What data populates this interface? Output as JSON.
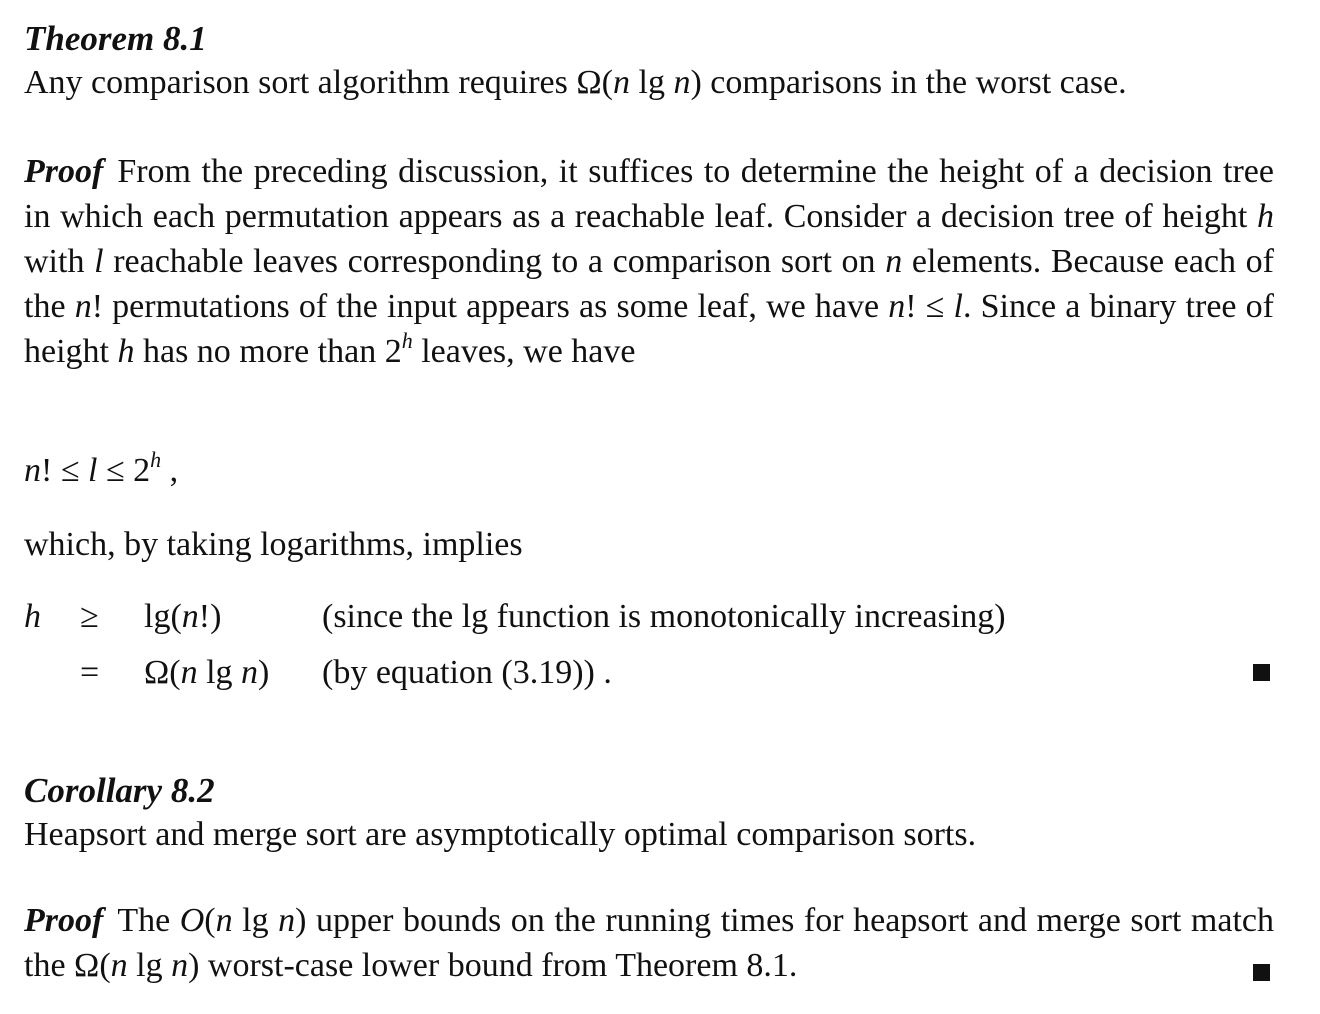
{
  "theorem": {
    "heading": "Theorem 8.1",
    "statement_pre": "Any comparison sort algorithm requires ",
    "omega": "Ω",
    "statement_math_open": "(",
    "statement_math_n1": "n",
    "statement_math_lg": " lg ",
    "statement_math_n2": "n",
    "statement_math_close": ")",
    "statement_post": " comparisons in the worst case."
  },
  "proof1": {
    "label": "Proof",
    "s1": "From the preceding discussion, it suffices to determine the height of a decision tree in which each permutation appears as a reachable leaf. Consider a decision tree of height ",
    "h": "h",
    "s2": " with ",
    "l": "l",
    "s3": " reachable leaves corresponding to a comparison sort on ",
    "n": "n",
    "s4": " elements. Because each of the ",
    "nfact": "n",
    "s5": "! permutations of the input appears as some leaf, we have ",
    "ineq_n": "n",
    "ineq_rest": "! ≤ ",
    "ineq_l": "l",
    "s6": ". Since a binary tree of height ",
    "h2": "h",
    "s7": " has no more than 2",
    "exp_h": "h",
    "s8": " leaves, we have"
  },
  "display_eq": {
    "n": "n",
    "p1": "! ≤ ",
    "l": "l",
    "p2": " ≤ 2",
    "exp": "h",
    "p3": " ,"
  },
  "implies_text": "which, by taking logarithms, implies",
  "align": {
    "row1": {
      "lhs": "h",
      "rel": "≥",
      "rhs_pre": "lg(",
      "rhs_n": "n",
      "rhs_post": "!)",
      "note": "(since the lg function is monotonically increasing)"
    },
    "row2": {
      "rel": "=",
      "rhs_omega": "Ω(",
      "rhs_n1": "n",
      "rhs_lg": " lg ",
      "rhs_n2": "n",
      "rhs_close": ")",
      "note": "(by equation (3.19))  ."
    }
  },
  "corollary": {
    "heading": "Corollary 8.2",
    "statement": "Heapsort and merge sort are asymptotically optimal comparison sorts."
  },
  "proof2": {
    "label": "Proof",
    "s1": "The ",
    "O": "O",
    "m_open": "(",
    "m_n1": "n",
    "m_lg": " lg ",
    "m_n2": "n",
    "m_close": ")",
    "s2": " upper bounds on the running times for heapsort and merge sort match the ",
    "omega": "Ω(",
    "m2_n1": "n",
    "m2_lg": " lg ",
    "m2_n2": "n",
    "m2_close": ")",
    "s3": " worst-case lower bound from Theorem 8.1."
  }
}
